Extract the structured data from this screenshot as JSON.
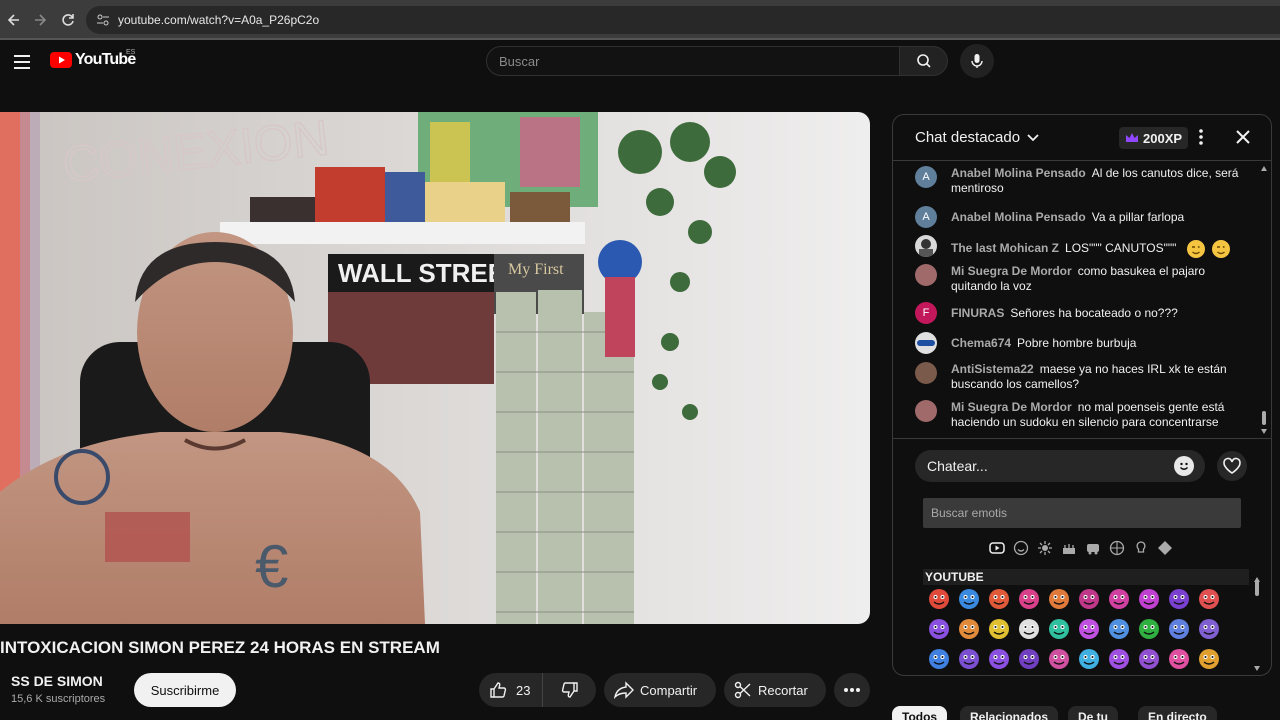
{
  "browser": {
    "url": "youtube.com/watch?v=A0a_P26pC2o"
  },
  "header": {
    "logo_text": "YouTube",
    "country_code": "ES",
    "search_placeholder": "Buscar"
  },
  "video": {
    "title": "INTOXICACION SIMON PEREZ 24 HORAS EN STREAM",
    "overlay_text_1": "CONEXION",
    "overlay_text_2": "WALL STREET",
    "overlay_text_3": "My First"
  },
  "channel": {
    "name": "SS DE SIMON",
    "subscribers": "15,6 K suscriptores",
    "subscribe_label": "Suscribirme"
  },
  "actions": {
    "like_count": "23",
    "share_label": "Compartir",
    "clip_label": "Recortar"
  },
  "chat": {
    "title": "Chat destacado",
    "xp_badge": "200XP",
    "messages": [
      {
        "author": "Anabel Molina Pensado",
        "text": "Al de los canutos dice, será mentiroso",
        "avatar_letter": "A",
        "avatar_color": "#5f7f9a"
      },
      {
        "author": "Anabel Molina Pensado",
        "text": "Va a pillar farlopa",
        "avatar_letter": "A",
        "avatar_color": "#5f7f9a"
      },
      {
        "author": "The last Mohican Z",
        "text": "LOS\"\"\" CANUTOS\"\"\"",
        "avatar_letter": "",
        "avatar_color": "#d8d8d8"
      },
      {
        "author": "Mi Suegra De Mordor",
        "text": "como basukea el pajaro quitando la voz",
        "avatar_letter": "",
        "avatar_color": "#a06a6a"
      },
      {
        "author": "FINURAS",
        "text": "Señores ha bocateado o no???",
        "avatar_letter": "F",
        "avatar_color": "#c2185b"
      },
      {
        "author": "Chema674",
        "text": "Pobre hombre burbuja",
        "avatar_letter": "",
        "avatar_color": "#e0e0e0"
      },
      {
        "author": "AntiSistema22",
        "text": "maese ya no haces IRL xk te están buscando los camellos?",
        "avatar_letter": "",
        "avatar_color": "#7a5a4a"
      },
      {
        "author": "Mi Suegra De Mordor",
        "text": "no mal poenseis gente está haciendo un sudoku en silencio para concentrarse",
        "avatar_letter": "",
        "avatar_color": "#a06a6a"
      }
    ],
    "input_placeholder": "Chatear...",
    "emoji_search_placeholder": "Buscar emotis",
    "emoji_section_label": "YOUTUBE"
  },
  "bottom_tabs": [
    "Todos",
    "Relacionados",
    "De tu",
    "En directo"
  ],
  "colors": {
    "yt_red": "#ff0000",
    "background": "#0f0f0f",
    "xp_crown": "#9146ff"
  }
}
